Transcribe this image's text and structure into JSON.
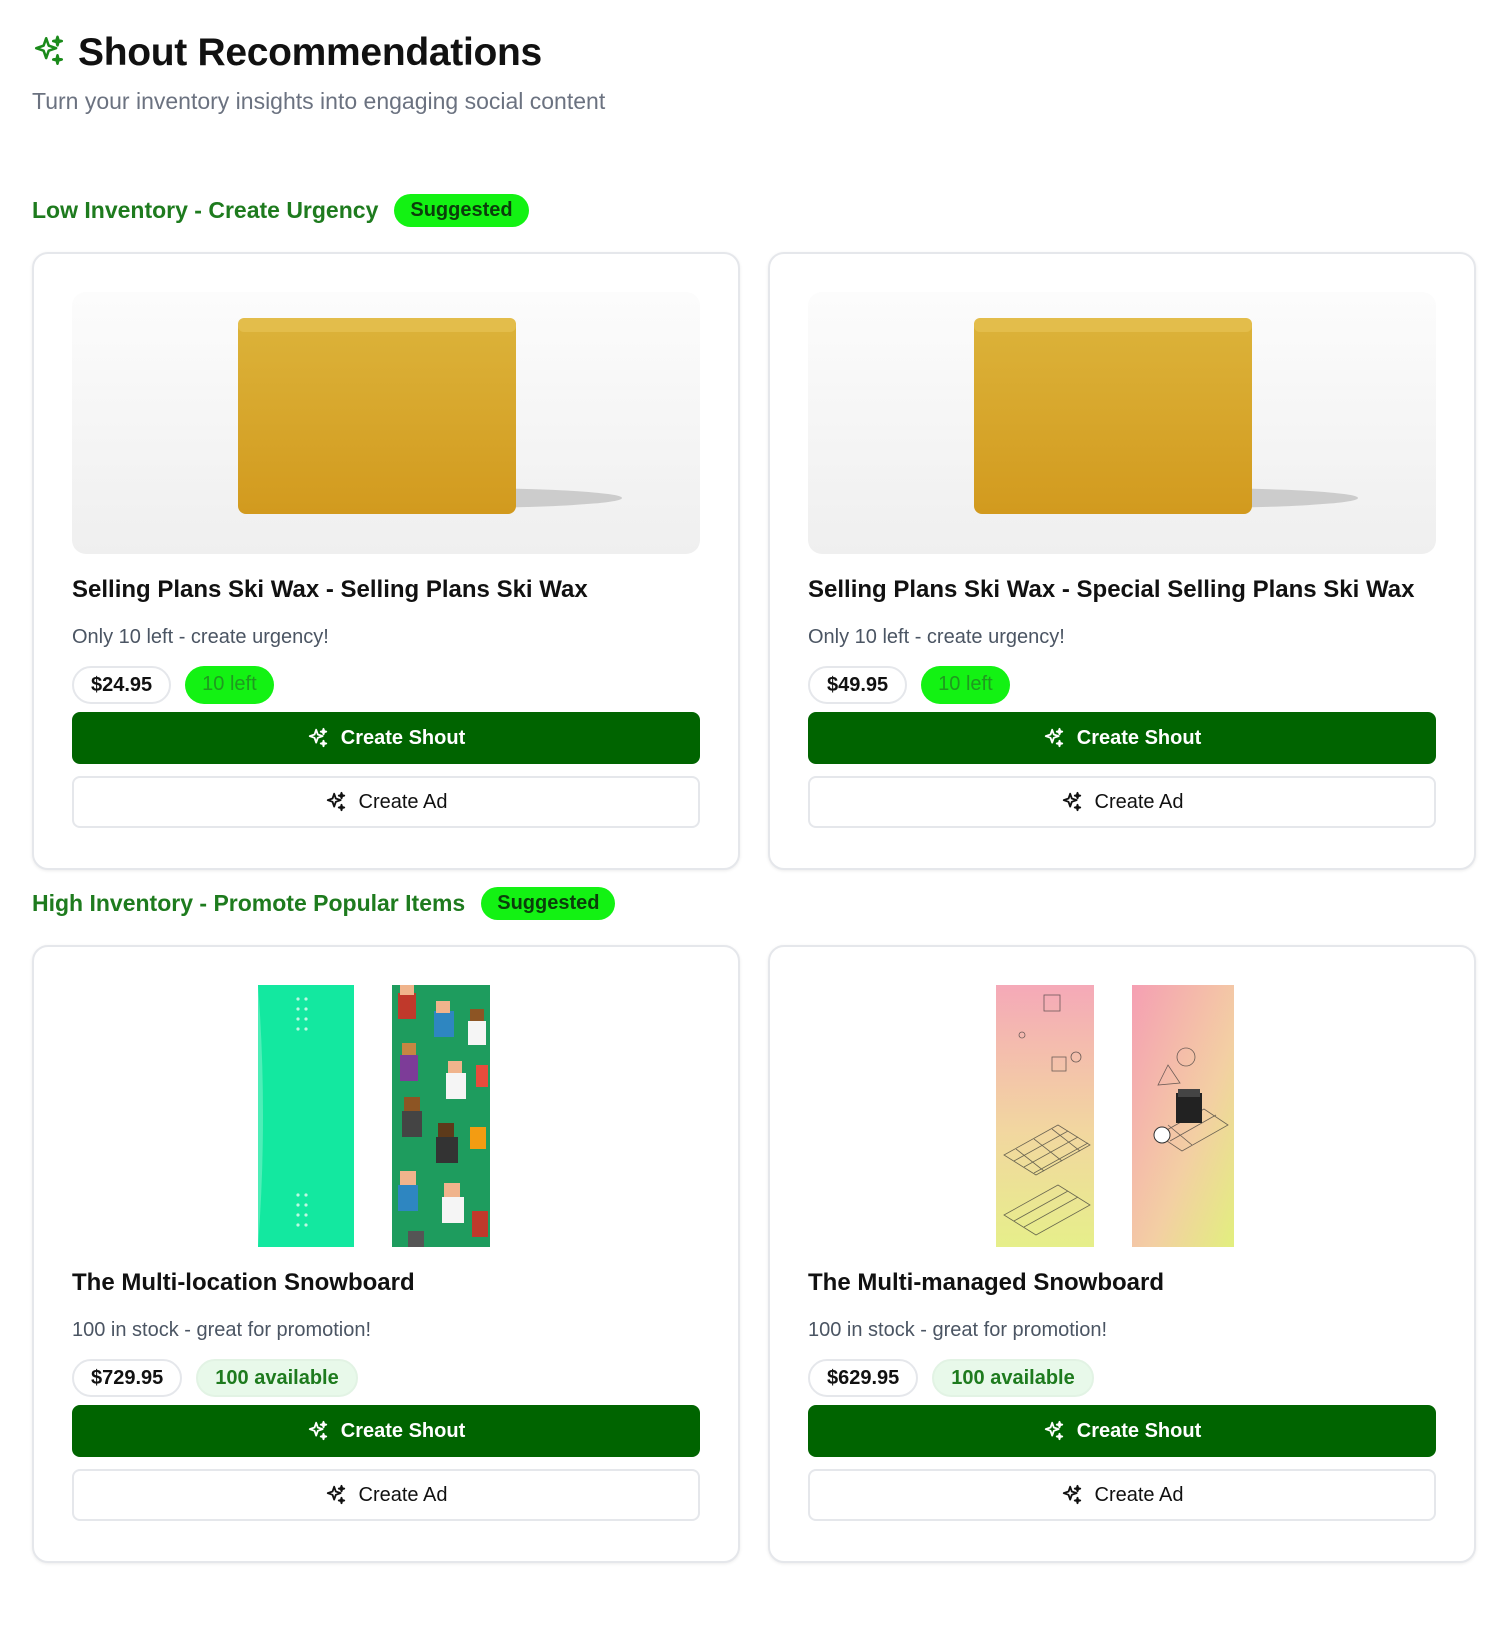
{
  "header": {
    "title": "Shout Recommendations",
    "subtitle": "Turn your inventory insights into engaging social content"
  },
  "colors": {
    "brand_green": "#006400",
    "section_title": "#1e7b1e",
    "suggested_badge": "#13f213"
  },
  "sections": [
    {
      "title": "Low Inventory - Create Urgency",
      "badge": "Suggested",
      "cards": [
        {
          "image_icon": "ski-wax-bar-image",
          "name": "Selling Plans Ski Wax - Selling Plans Ski Wax",
          "description": "Only 10 left - create urgency!",
          "price": "$24.95",
          "stock": "10 left",
          "primary_action": "Create Shout",
          "secondary_action": "Create Ad"
        },
        {
          "image_icon": "ski-wax-bar-image",
          "name": "Selling Plans Ski Wax - Special Selling Plans Ski Wax",
          "description": "Only 10 left - create urgency!",
          "price": "$49.95",
          "stock": "10 left",
          "primary_action": "Create Shout",
          "secondary_action": "Create Ad"
        }
      ]
    },
    {
      "title": "High Inventory - Promote Popular Items",
      "badge": "Suggested",
      "cards": [
        {
          "image_icon": "snowboard-green-pixel-image",
          "name": "The Multi-location Snowboard",
          "description": "100 in stock - great for promotion!",
          "price": "$729.95",
          "stock": "100 available",
          "primary_action": "Create Shout",
          "secondary_action": "Create Ad"
        },
        {
          "image_icon": "snowboard-pink-gradient-image",
          "name": "The Multi-managed Snowboard",
          "description": "100 in stock - great for promotion!",
          "price": "$629.95",
          "stock": "100 available",
          "primary_action": "Create Shout",
          "secondary_action": "Create Ad"
        }
      ]
    }
  ]
}
